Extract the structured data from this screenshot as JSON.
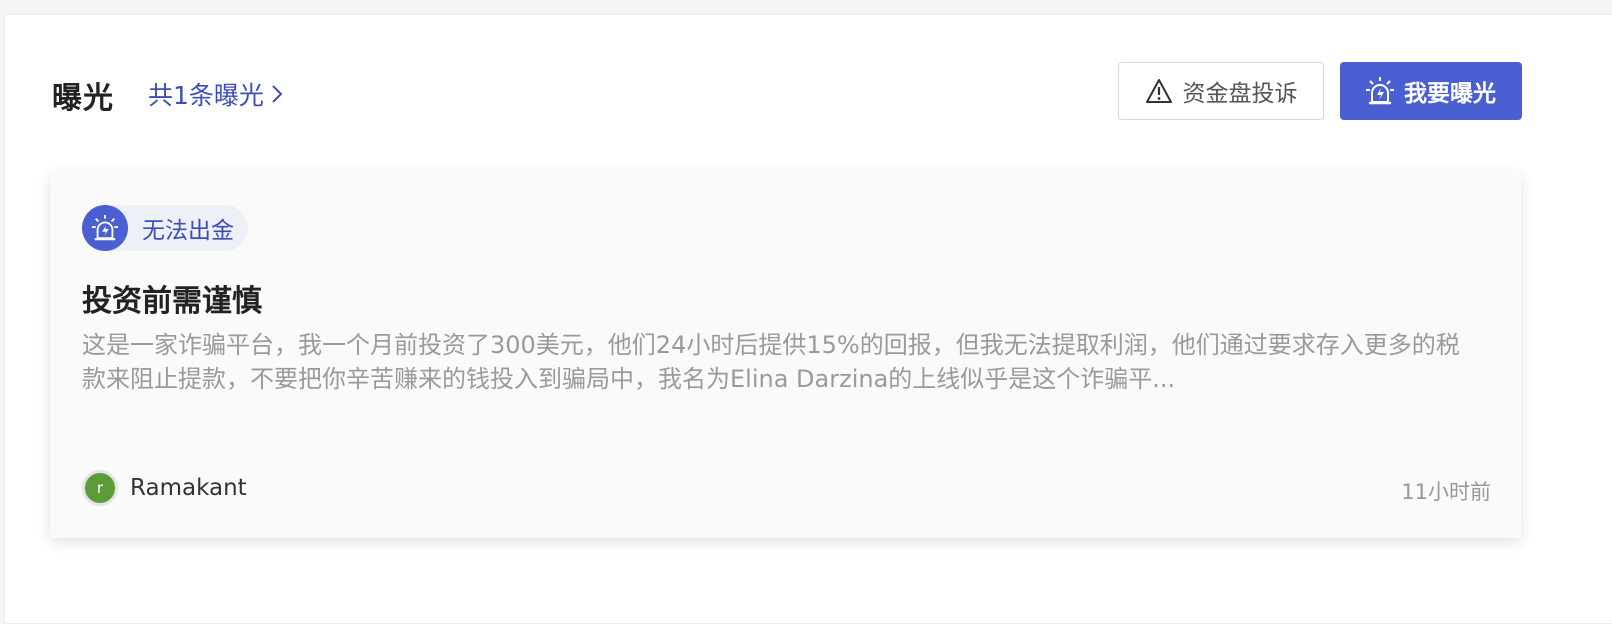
{
  "header": {
    "title": "曝光",
    "count_link": "共1条曝光",
    "complaint_button": "资金盘投诉",
    "expose_button": "我要曝光"
  },
  "card": {
    "tag": "无法出金",
    "title": "投资前需谨慎",
    "body": "这是一家诈骗平台，我一个月前投资了300美元，他们24小时后提供15%的回报，但我无法提取利润，他们通过要求存入更多的税款来阻止提款，不要把你辛苦赚来的钱投入到骗局中，我名为Elina Darzina的上线似乎是这个诈骗平...",
    "author": {
      "avatar_letter": "r",
      "name": "Ramakant"
    },
    "time": "11小时前"
  },
  "colors": {
    "accent": "#4a5fd2",
    "link": "#3d4db7",
    "avatar": "#5b9b3a"
  },
  "icons": {
    "complaint": "warning-triangle-icon",
    "expose": "alarm-siren-icon",
    "more": "chevron-right-icon"
  }
}
